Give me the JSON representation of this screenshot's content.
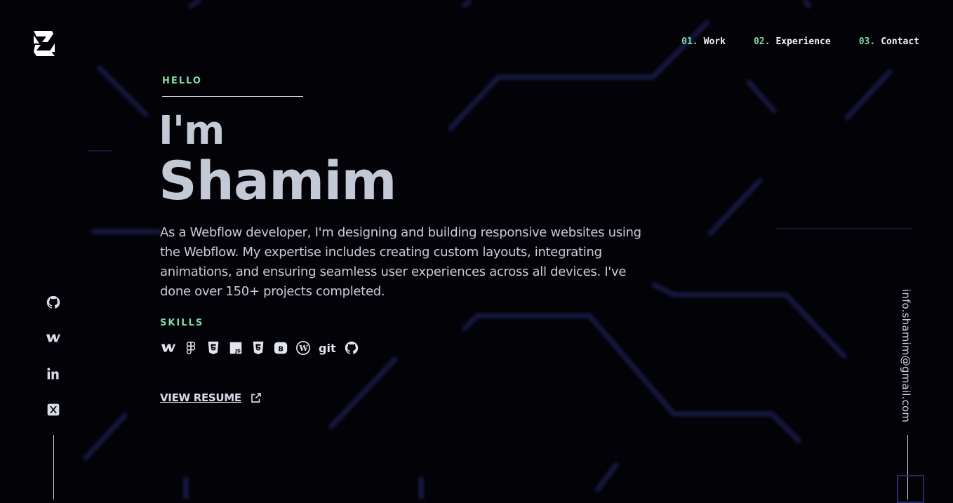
{
  "brand": {
    "logo": "logo-mark"
  },
  "nav": [
    {
      "num": "01.",
      "label": "Work"
    },
    {
      "num": "02.",
      "label": "Experience"
    },
    {
      "num": "03.",
      "label": "Contact"
    }
  ],
  "hero": {
    "kicker": "HELLO",
    "greeting": "I'm",
    "name": "Shamim",
    "bio": "As a Webflow developer, I'm designing and building responsive websites using the Webflow. My expertise includes creating custom layouts, integrating animations, and ensuring seamless user experiences across all devices. I've done over 150+ projects completed."
  },
  "skills": {
    "label": "SKILLS",
    "items": [
      "webflow-icon",
      "figma-icon",
      "html5-icon",
      "js-icon",
      "css3-icon",
      "bootstrap-icon",
      "wordpress-icon",
      "git",
      "github-icon"
    ],
    "git_label": "git"
  },
  "resume": {
    "label": "VIEW RESUME",
    "icon": "external-link-icon"
  },
  "social": [
    "github-icon",
    "webflow-icon",
    "linkedin-icon",
    "x-icon"
  ],
  "contact": {
    "email": "info.shamim@gmail.com"
  },
  "colors": {
    "accent": "#7fd9a3",
    "background": "#030307",
    "text": "#c4c9d6",
    "glow": "#2a2870"
  }
}
